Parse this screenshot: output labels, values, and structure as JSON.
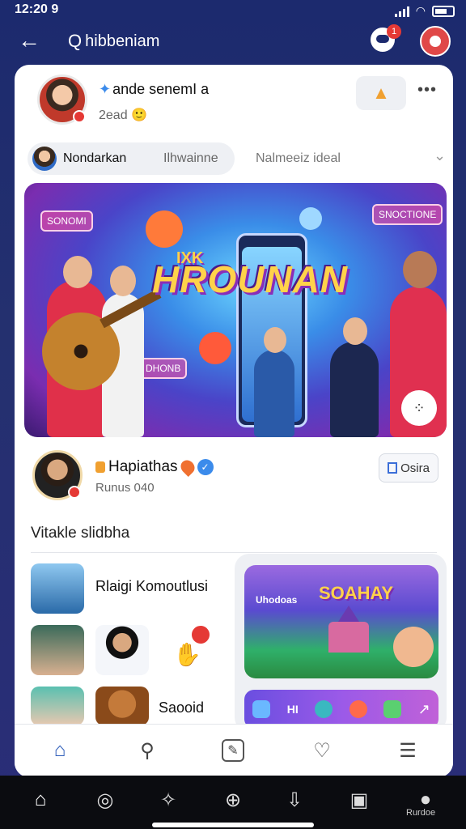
{
  "status_bar": {
    "time": "12:20 9"
  },
  "top_bar": {
    "back_icon": "arrow-left-icon",
    "search_text": "hibbeniam",
    "message_badge": "1"
  },
  "post": {
    "author_name": "ande senemI a",
    "time": "2ead",
    "time_emoji": "🙂",
    "follow_icon": "thumbs-up-icon",
    "more_label": "•••"
  },
  "chip": {
    "name": "Nondarkan",
    "subtitle": "Ilhwainne",
    "right_text": "Nalmeeiz ideal"
  },
  "hero": {
    "title_art": "HROUNAN",
    "small_art": "IXK",
    "signs": [
      "SONOMI",
      "SNOCTIONE",
      "DHONB"
    ]
  },
  "channel": {
    "name": "Hapiathas",
    "subtitle": "Runus 040",
    "button_label": "Osira"
  },
  "section": {
    "title": "Vitakle slidbha"
  },
  "list": [
    {
      "label": "Rlaigi Komoutlusi"
    },
    {
      "label": ""
    },
    {
      "label": "Saooid"
    }
  ],
  "side_panel": {
    "game_title": "SOAHAY",
    "game_sub": "Uhodoas",
    "apps_card_labels": [
      "HI"
    ]
  },
  "inner_nav": [
    "home-icon",
    "search-icon",
    "edit-icon",
    "heart-icon",
    "menu-icon"
  ],
  "system_nav": {
    "profile_label": "Rurdoe"
  },
  "colors": {
    "background": "#1c2a6e",
    "accent_blue": "#3b8beb",
    "badge_red": "#e53935"
  }
}
